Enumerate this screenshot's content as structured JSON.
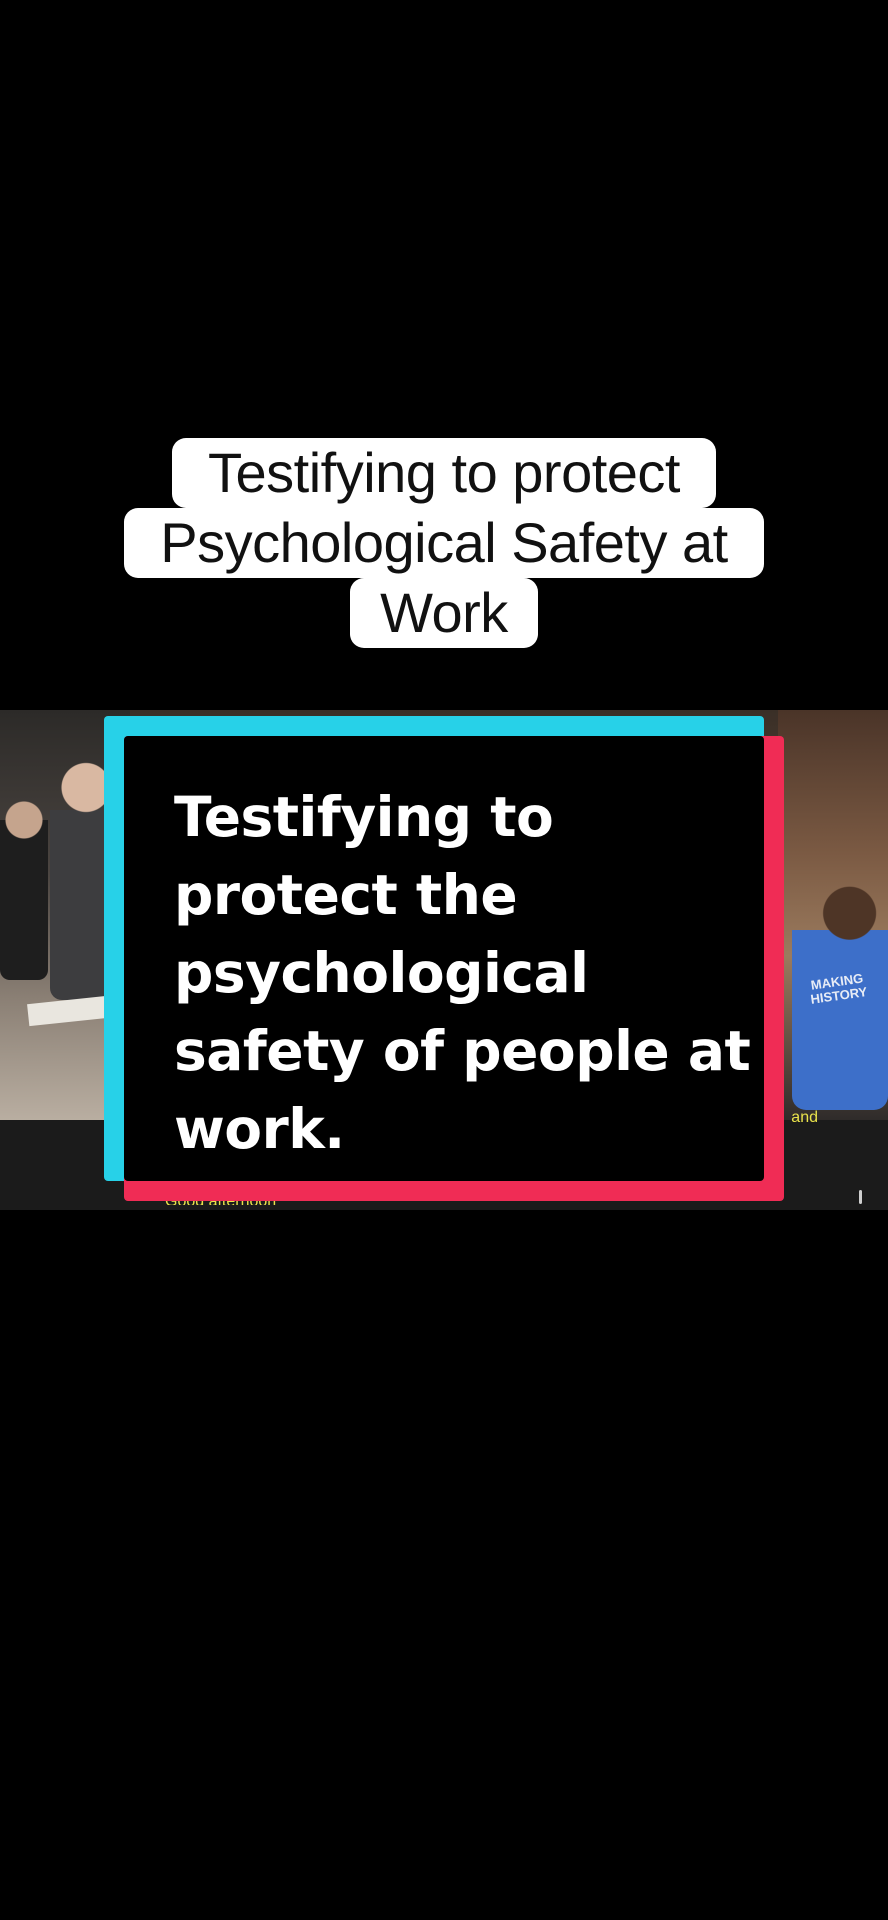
{
  "caption": {
    "lines": [
      "Testifying to protect",
      "Psychological Safety at",
      "Work"
    ]
  },
  "video": {
    "shirt_text": "MAKING HISTORY",
    "subtitle_right": "and",
    "subtitle_bottom": "Good afternoon"
  },
  "card": {
    "lines": [
      "Testifying to",
      "protect the",
      "psychological",
      "safety of people at",
      "work."
    ],
    "colors": {
      "cyan": "#27d1e8",
      "pink": "#f02c55",
      "fill": "#000000",
      "text": "#ffffff"
    }
  }
}
